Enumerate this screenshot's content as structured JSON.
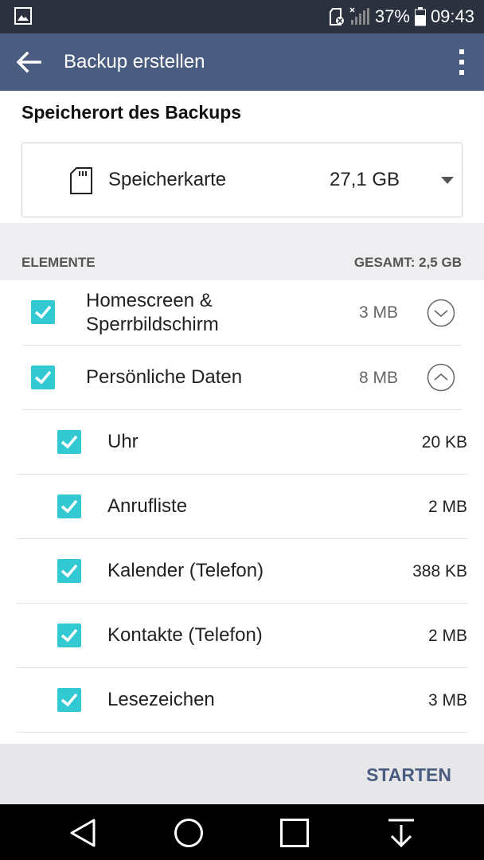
{
  "status_bar": {
    "battery": "37%",
    "time": "09:43"
  },
  "app_bar": {
    "title": "Backup erstellen"
  },
  "storage": {
    "section_title": "Speicherort des Backups",
    "location": "Speicherkarte",
    "free_space": "27,1 GB"
  },
  "elements": {
    "header_label": "ELEMENTE",
    "total": "GESAMT: 2,5 GB",
    "groups": [
      {
        "label": "Homescreen &\nSperrbildschirm",
        "size": "3 MB",
        "checked": true,
        "expanded": false
      },
      {
        "label": "Persönliche Daten",
        "size": "8 MB",
        "checked": true,
        "expanded": true
      }
    ],
    "children": [
      {
        "label": "Uhr",
        "size": "20 KB",
        "checked": true
      },
      {
        "label": "Anrufliste",
        "size": "2 MB",
        "checked": true
      },
      {
        "label": "Kalender (Telefon)",
        "size": "388 KB",
        "checked": true
      },
      {
        "label": "Kontakte (Telefon)",
        "size": "2 MB",
        "checked": true
      },
      {
        "label": "Lesezeichen",
        "size": "3 MB",
        "checked": true
      }
    ]
  },
  "actions": {
    "start_label": "STARTEN"
  },
  "colors": {
    "app_bar": "#4a5d80",
    "status_bar": "#2c3140",
    "checkbox": "#33c9d3",
    "action_text": "#4a5d80"
  }
}
